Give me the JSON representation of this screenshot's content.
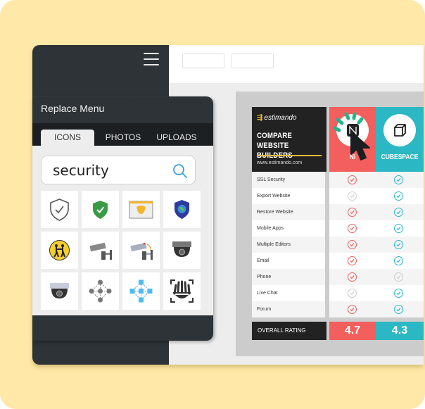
{
  "colors": {
    "background": "#ffe8a8",
    "dark": "#2d3336",
    "coral": "#f25f5c",
    "teal": "#2bb8c4",
    "gold": "#e9b83a"
  },
  "toolbar": {
    "menu_icon": "hamburger-icon"
  },
  "replace_menu": {
    "title": "Replace Menu",
    "tabs": [
      {
        "label": "ICONS",
        "active": true
      },
      {
        "label": "PHOTOS",
        "active": false
      },
      {
        "label": "UPLOADS",
        "active": false
      }
    ],
    "search": {
      "value": "security",
      "icon": "search-icon"
    },
    "results": [
      {
        "name": "shield-check-outline-icon"
      },
      {
        "name": "shield-check-green-icon"
      },
      {
        "name": "browser-shield-icon"
      },
      {
        "name": "shield-globe-icon"
      },
      {
        "name": "school-crossing-sign-icon"
      },
      {
        "name": "security-camera-icon"
      },
      {
        "name": "security-camera-wired-icon"
      },
      {
        "name": "dome-camera-dark-icon"
      },
      {
        "name": "dome-camera-light-icon"
      },
      {
        "name": "network-nodes-gray-icon"
      },
      {
        "name": "network-cubes-blue-icon"
      },
      {
        "name": "hand-scanner-icon"
      }
    ]
  },
  "comparison": {
    "brand": "estimando",
    "title_line1": "COMPARE",
    "title_line2": "WEBSITE BUILDERS",
    "url": "www.estimando.com",
    "columns": [
      {
        "label": "NI",
        "icon": "n-logo-icon"
      },
      {
        "label": "CUBESPACE",
        "icon": "cube-icon"
      }
    ],
    "features": [
      {
        "label": "SSL Security",
        "n": true,
        "c": true
      },
      {
        "label": "Export Website",
        "n": false,
        "c": true
      },
      {
        "label": "Restore Website",
        "n": true,
        "c": true
      },
      {
        "label": "Mobile Apps",
        "n": true,
        "c": true
      },
      {
        "label": "Multiple Editors",
        "n": true,
        "c": true
      },
      {
        "label": "Email",
        "n": true,
        "c": true
      },
      {
        "label": "Phone",
        "n": true,
        "c": false
      },
      {
        "label": "Live Chat",
        "n": false,
        "c": true
      },
      {
        "label": "Forum",
        "n": true,
        "c": true
      }
    ],
    "rating_label": "OVERALL RATING",
    "ratings": [
      "4.7",
      "4.3"
    ]
  }
}
